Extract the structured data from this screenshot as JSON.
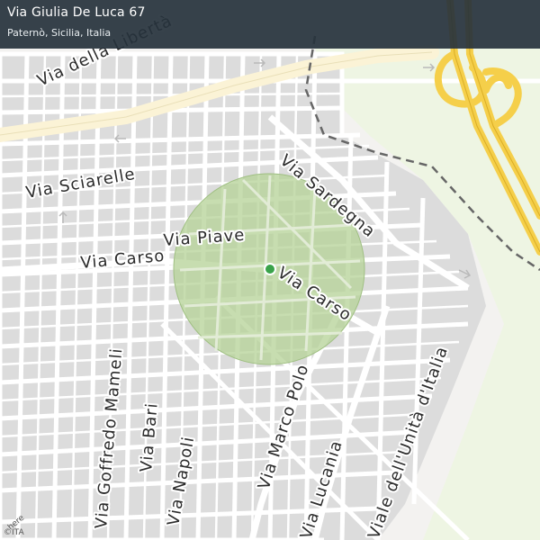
{
  "header": {
    "title": "Via Giulia De Luca 67",
    "subtitle": "Paternò, Sicilia, Italia"
  },
  "map": {
    "colors": {
      "land": "#f3f2f0",
      "block": "#dcdcdc",
      "road": "#ffffff",
      "main_road": "#fbf3d6",
      "highway": "#f5cf4a",
      "green": "#eef5e3",
      "area_fill": "#b7d39a",
      "area_stroke": "#9fbf82",
      "marker": "#3aa34a",
      "boundary": "#666666"
    },
    "streets": [
      "Via della Libertà",
      "Via Sciarelle",
      "Via Piave",
      "Via Carso",
      "Via Carso",
      "Via Sardegna",
      "Via Goffredo Mameli",
      "Via Bari",
      "Via Napoli",
      "Via Marco Polo",
      "Via Lucania",
      "Viale dell'Unità d'Italia"
    ],
    "marker_icon": "location-dot"
  },
  "attribution": {
    "logo": "here",
    "text": "©ITA"
  }
}
